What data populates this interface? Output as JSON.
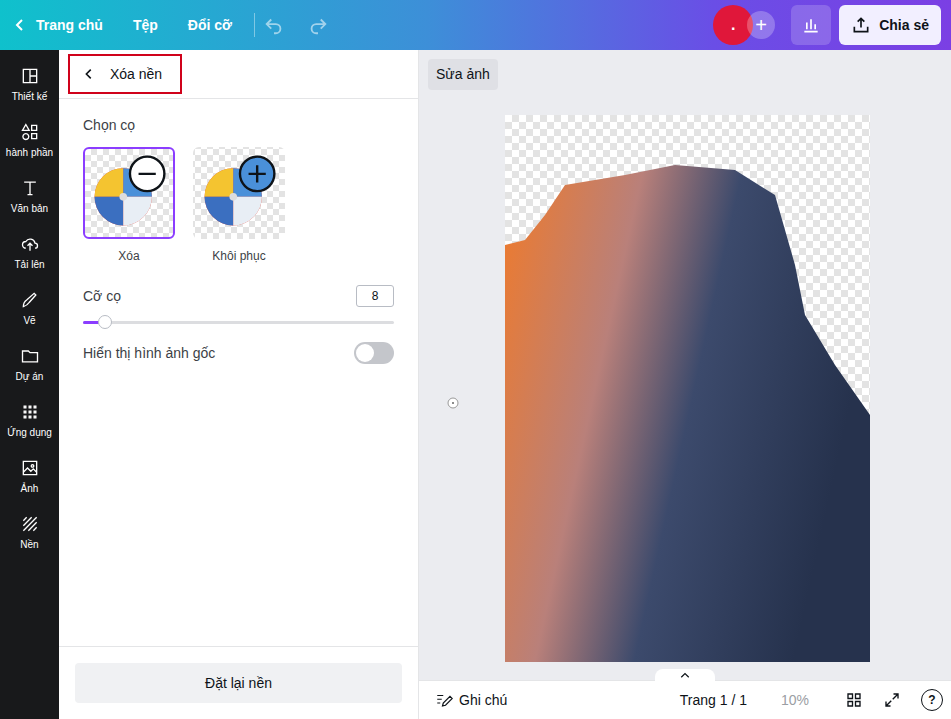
{
  "topbar": {
    "home": "Trang chủ",
    "menu": [
      "Tệp",
      "Đổi cỡ"
    ],
    "avatar": ".",
    "add": "+",
    "share": "Chia sẻ"
  },
  "sidebar": {
    "items": [
      {
        "label": "Thiết kế",
        "selected": false
      },
      {
        "label": "hành phần",
        "selected": false
      },
      {
        "label": "Văn bản",
        "selected": false
      },
      {
        "label": "Tải lên",
        "selected": false
      },
      {
        "label": "Vẽ",
        "selected": false
      },
      {
        "label": "Dự án",
        "selected": false
      },
      {
        "label": "Ứng dụng",
        "selected": false
      },
      {
        "label": "Ảnh",
        "selected": false
      },
      {
        "label": "Nền",
        "selected": false
      }
    ]
  },
  "panel": {
    "title": "Xóa nền",
    "brush_heading": "Chọn cọ",
    "brushes": [
      {
        "label": "Xóa",
        "selected": true,
        "kind": "erase"
      },
      {
        "label": "Khôi phục",
        "selected": false,
        "kind": "restore"
      }
    ],
    "size_label": "Cỡ cọ",
    "size_value": "8",
    "size_level": 0.07,
    "original_label": "Hiển thị hình ảnh gốc",
    "original_on": false,
    "reset": "Đặt lại nền"
  },
  "canvas": {
    "edit_button": "Sửa ảnh"
  },
  "footer": {
    "notes": "Ghi chú",
    "page": "Trang 1 / 1",
    "zoom": "10%",
    "help": "?"
  }
}
